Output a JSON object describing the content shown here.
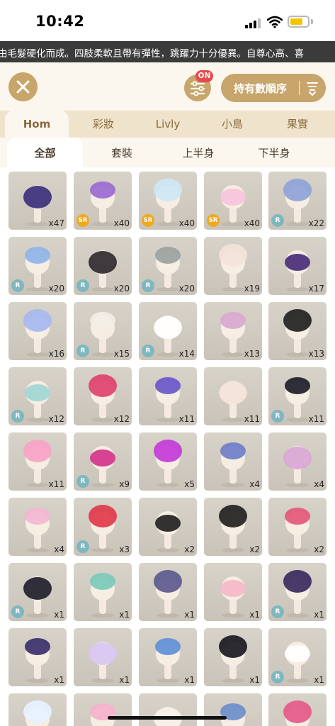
{
  "status_bar": {
    "time": "10:42"
  },
  "ticker": {
    "text": "由毛髮硬化而成。四肢柔軟且帶有彈性，跳躍力十分優異。自尊心高、喜"
  },
  "toolbar": {
    "filter_badge": "ON",
    "sort_label": "持有數順序"
  },
  "category_tabs": [
    {
      "label": "Hom",
      "active": true
    },
    {
      "label": "彩妝",
      "active": false
    },
    {
      "label": "Livly",
      "active": false
    },
    {
      "label": "小島",
      "active": false
    },
    {
      "label": "果實",
      "active": false
    }
  ],
  "sub_tabs": [
    {
      "label": "全部",
      "active": true
    },
    {
      "label": "套裝",
      "active": false
    },
    {
      "label": "上半身",
      "active": false
    },
    {
      "label": "下半身",
      "active": false
    }
  ],
  "items": [
    {
      "name": "guitar-pick",
      "count": "x47",
      "rarity": ""
    },
    {
      "name": "purple-bun-hair",
      "count": "x40",
      "rarity": "SR"
    },
    {
      "name": "icy-blue-hair",
      "count": "x40",
      "rarity": "SR"
    },
    {
      "name": "pink-twin-tail-hair",
      "count": "x40",
      "rarity": "SR"
    },
    {
      "name": "unicorn-float",
      "count": "x22",
      "rarity": "R"
    },
    {
      "name": "star-balloon",
      "count": "x20",
      "rarity": "R"
    },
    {
      "name": "black-pink-hair",
      "count": "x20",
      "rarity": "R"
    },
    {
      "name": "gray-teal-hair",
      "count": "x20",
      "rarity": "R"
    },
    {
      "name": "blush-face",
      "count": "x19",
      "rarity": ""
    },
    {
      "name": "cassette-tape",
      "count": "x17",
      "rarity": ""
    },
    {
      "name": "rainbow-cloud",
      "count": "x16",
      "rarity": ""
    },
    {
      "name": "mini-white-hat",
      "count": "x15",
      "rarity": "R"
    },
    {
      "name": "white-tutu-dress",
      "count": "x14",
      "rarity": "R"
    },
    {
      "name": "pink-glasses",
      "count": "x13",
      "rarity": ""
    },
    {
      "name": "black-boots",
      "count": "x13",
      "rarity": ""
    },
    {
      "name": "beige-teal-hair",
      "count": "x12",
      "rarity": "R"
    },
    {
      "name": "pink-skirt",
      "count": "x12",
      "rarity": ""
    },
    {
      "name": "jester-collar",
      "count": "x11",
      "rarity": ""
    },
    {
      "name": "heart-sticker",
      "count": "x11",
      "rarity": ""
    },
    {
      "name": "mini-top-hat",
      "count": "x11",
      "rarity": "R"
    },
    {
      "name": "pink-short-hair",
      "count": "x11",
      "rarity": ""
    },
    {
      "name": "party-mini-hat",
      "count": "x9",
      "rarity": "R"
    },
    {
      "name": "candy-bag",
      "count": "x5",
      "rarity": ""
    },
    {
      "name": "party-cone-hat",
      "count": "x4",
      "rarity": ""
    },
    {
      "name": "pink-star-hood",
      "count": "x4",
      "rarity": ""
    },
    {
      "name": "pastel-outfit",
      "count": "x4",
      "rarity": ""
    },
    {
      "name": "sundae-hat",
      "count": "x3",
      "rarity": "R"
    },
    {
      "name": "black-shoes-socks",
      "count": "x2",
      "rarity": ""
    },
    {
      "name": "black-outfit",
      "count": "x2",
      "rarity": ""
    },
    {
      "name": "pink-long-skirt",
      "count": "x2",
      "rarity": ""
    },
    {
      "name": "black-mini-hat",
      "count": "x1",
      "rarity": "R"
    },
    {
      "name": "mint-hair-band",
      "count": "x1",
      "rarity": ""
    },
    {
      "name": "purple-ruff-collar",
      "count": "x1",
      "rarity": ""
    },
    {
      "name": "pink-ruff-collar",
      "count": "x1",
      "rarity": ""
    },
    {
      "name": "purple-clown-suit",
      "count": "x1",
      "rarity": "R"
    },
    {
      "name": "striped-leggings",
      "count": "x1",
      "rarity": ""
    },
    {
      "name": "rainbow-head-swirl",
      "count": "x1",
      "rarity": ""
    },
    {
      "name": "gem-necklace",
      "count": "x1",
      "rarity": ""
    },
    {
      "name": "black-coat",
      "count": "x1",
      "rarity": ""
    },
    {
      "name": "white-robe",
      "count": "x1",
      "rarity": "R"
    },
    {
      "name": "white-cape",
      "count": "",
      "rarity": ""
    },
    {
      "name": "cupcake-hat",
      "count": "",
      "rarity": ""
    },
    {
      "name": "white-hood",
      "count": "",
      "rarity": ""
    },
    {
      "name": "striped-collar",
      "count": "",
      "rarity": ""
    },
    {
      "name": "pink-jacket",
      "count": "",
      "rarity": ""
    }
  ]
}
